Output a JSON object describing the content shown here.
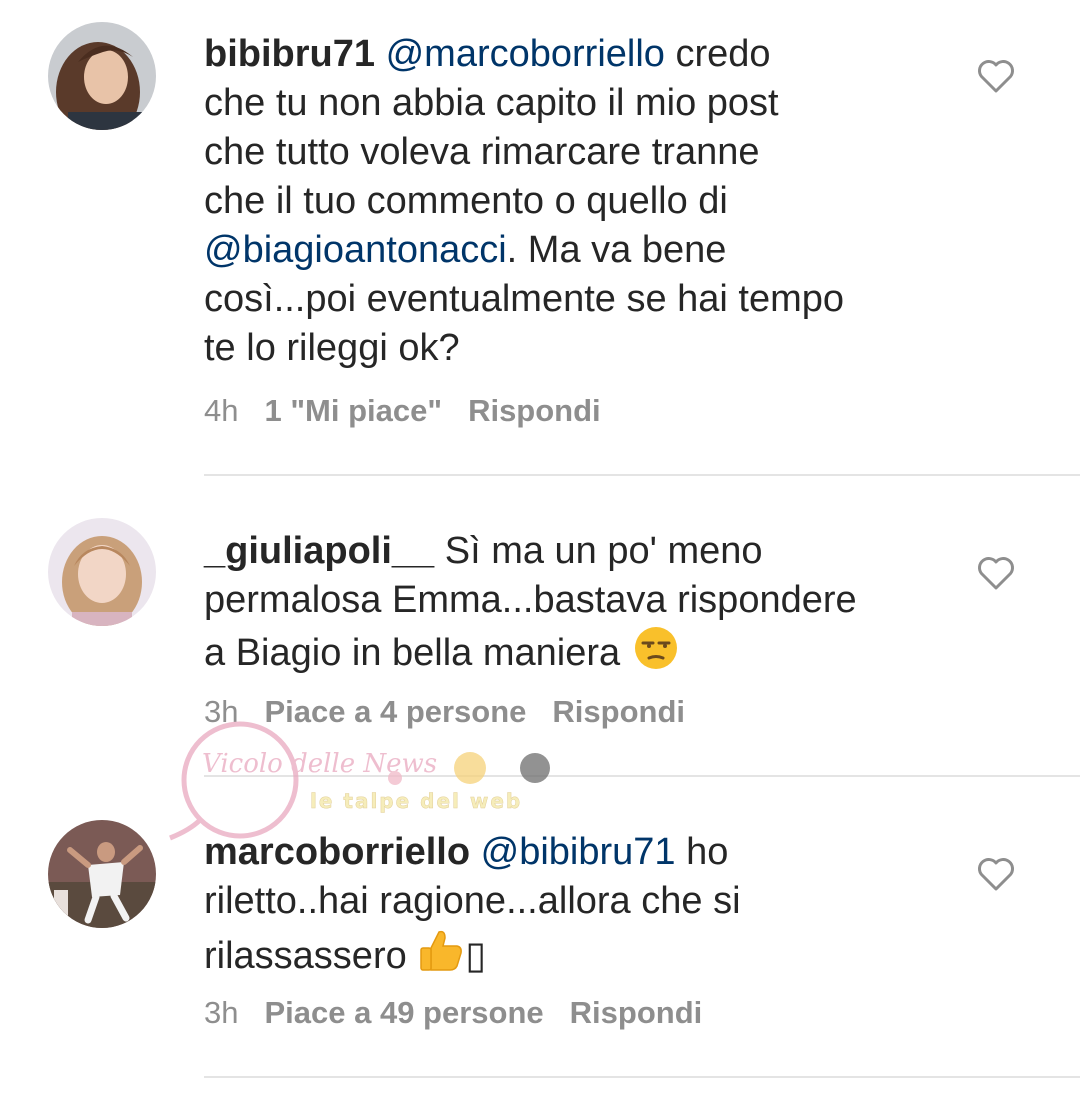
{
  "comments": [
    {
      "username": "bibibru71",
      "mention": "@marcoborriello",
      "text_a": " credo\nche tu non abbia capito il mio post\nche tutto voleva rimarcare tranne\nche il tuo commento o quello di\n",
      "mention2": "@biagioantonacci",
      "text_b": ". Ma va bene\ncosì...poi eventualmente se hai tempo\nte lo rileggi ok?",
      "time": "4h",
      "likes": "1 \"Mi piace\"",
      "reply": "Rispondi",
      "avatar_icon": "avatar-woman-dark-hair",
      "like_icon": "heart-outline-icon"
    },
    {
      "username": "_giuliapoli__",
      "text_a": " Sì ma un po' meno\npermalosa Emma...bastava rispondere\na Biagio in bella maniera ",
      "emoji": "unamused-face",
      "time": "3h",
      "likes": "Piace a 4 persone",
      "reply": "Rispondi",
      "avatar_icon": "avatar-woman-blonde",
      "like_icon": "heart-outline-icon"
    },
    {
      "username": "marcoborriello",
      "mention": "@bibibru71",
      "text_a": " ho\nriletto..hai ragione...allora che si\nrilassassero ",
      "emoji": "thumbs-up",
      "trailing_glyph": "▯",
      "time": "3h",
      "likes": "Piace a 49 persone",
      "reply": "Rispondi",
      "avatar_icon": "avatar-footballer",
      "like_icon": "heart-outline-icon"
    }
  ],
  "watermark": {
    "logo_text": "Vicolo delle News",
    "tagline": "le talpe del web"
  },
  "colors": {
    "text": "#262626",
    "mention": "#003569",
    "meta": "#8e8e8e",
    "divider": "#e4e4e4"
  }
}
